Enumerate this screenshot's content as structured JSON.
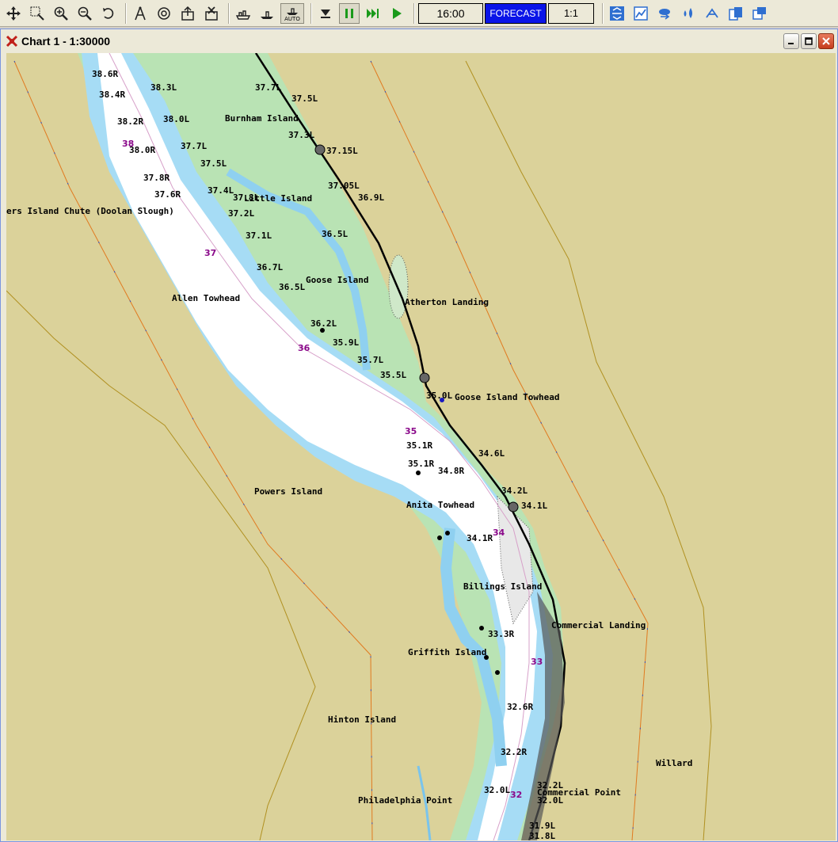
{
  "toolbar": {
    "time": "16:00",
    "forecast_label": "FORECAST",
    "ratio": "1:1",
    "auto_label": "AUTO"
  },
  "window": {
    "title": "Chart 1 - 1:30000"
  },
  "map": {
    "places": [
      {
        "id": "burnham-island",
        "text": "Burnham Island"
      },
      {
        "id": "little-island",
        "text": "Little Island"
      },
      {
        "id": "powers-island-chute",
        "text": "ers Island Chute (Doolan Slough)"
      },
      {
        "id": "goose-island",
        "text": "Goose Island"
      },
      {
        "id": "allen-towhead",
        "text": "Allen Towhead"
      },
      {
        "id": "atherton-landing",
        "text": "Atherton Landing"
      },
      {
        "id": "goose-island-towhead",
        "text": "Goose Island Towhead"
      },
      {
        "id": "powers-island",
        "text": "Powers Island"
      },
      {
        "id": "anita-towhead",
        "text": "Anita Towhead"
      },
      {
        "id": "billings-island",
        "text": "Billings Island"
      },
      {
        "id": "commercial-landing",
        "text": "Commercial Landing"
      },
      {
        "id": "griffith-island",
        "text": "Griffith Island"
      },
      {
        "id": "hinton-island",
        "text": "Hinton Island"
      },
      {
        "id": "willard",
        "text": "Willard"
      },
      {
        "id": "philadelphia-point",
        "text": "Philadelphia Point"
      },
      {
        "id": "commercial-point",
        "text": "Commercial Point"
      }
    ],
    "mile_markers": [
      "38",
      "37",
      "36",
      "35",
      "34",
      "33",
      "32"
    ],
    "mile_labels": [
      "38.6R",
      "38.3L",
      "38.4R",
      "38.2R",
      "38.0L",
      "38.0R",
      "37.7L",
      "37.5L",
      "37.8R",
      "37.6R",
      "37.4L",
      "37.2L",
      "37.1L",
      "36.7L",
      "36.5L",
      "36.2L",
      "35.9L",
      "35.7L",
      "35.5L",
      "35.0L",
      "35.1R",
      "35.1R",
      "34.8R",
      "34.1R",
      "33.3R",
      "32.6R",
      "32.2R",
      "32.0L",
      "37.7L",
      "37.5L",
      "37.3L",
      "37.15L",
      "37.05L",
      "36.9L",
      "36.5L",
      "34.6L",
      "34.2L",
      "34.1L",
      "32.2L",
      "32.0L",
      "31.9L",
      "31.8L",
      "37.8L"
    ]
  }
}
